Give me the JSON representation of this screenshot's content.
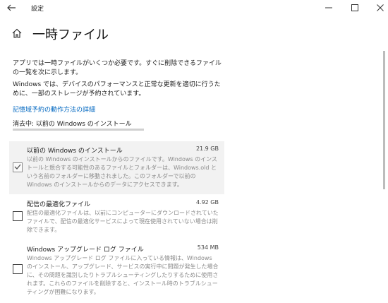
{
  "window": {
    "title": "設定",
    "back_icon": "arrow-left-icon",
    "controls": [
      "minimize-icon",
      "maximize-icon",
      "close-icon"
    ]
  },
  "header": {
    "home_icon": "home-icon",
    "title": "一時ファイル"
  },
  "intro": {
    "line1": "アプリでは一時ファイルがいくつか必要です。すぐに削除できるファイルの一覧を次に示します。",
    "line2": "Windows では、デバイスのパフォーマンスと正常な更新を適切に行うために、一部のストレージが予約されています。"
  },
  "link": {
    "label": "記憶域予約の動作方法の詳細"
  },
  "status": {
    "label": "消去中: 以前の Windows のインストール"
  },
  "items": [
    {
      "title": "以前の Windows のインストール",
      "size": "21.9 GB",
      "checked": true,
      "description": "以前の Windows のインストールからのファイルです。Windows のインストールと競合する可能性のあるファイルとフォルダーは、Windows.old という名前のフォルダーに移動されました。このフォルダーで以前の Windows のインストールからのデータにアクセスできます。"
    },
    {
      "title": "配信の最適化ファイル",
      "size": "4.92 GB",
      "checked": false,
      "description": "配信の最適化ファイルは、以前にコンピューターにダウンロードされていたファイルで、配信の最適化サービスによって現在使用されていない場合は削除できます。"
    },
    {
      "title": "Windows アップグレード ログ ファイル",
      "size": "534 MB",
      "checked": false,
      "description": "Windows アップグレード ログ ファイルに入っている情報は、Windows のインストール、アップグレード、サービスの実行中に問題が発生した場合に、その問題を識別したりトラブルシューティングしたりするために使用されます。これらのファイルを削除すると、インストール時のトラブルシューティングが困難になります。"
    }
  ],
  "colors": {
    "link": "#0067c0",
    "selected_bg": "#f2f2f2",
    "desc_text": "#8a8a8a"
  }
}
